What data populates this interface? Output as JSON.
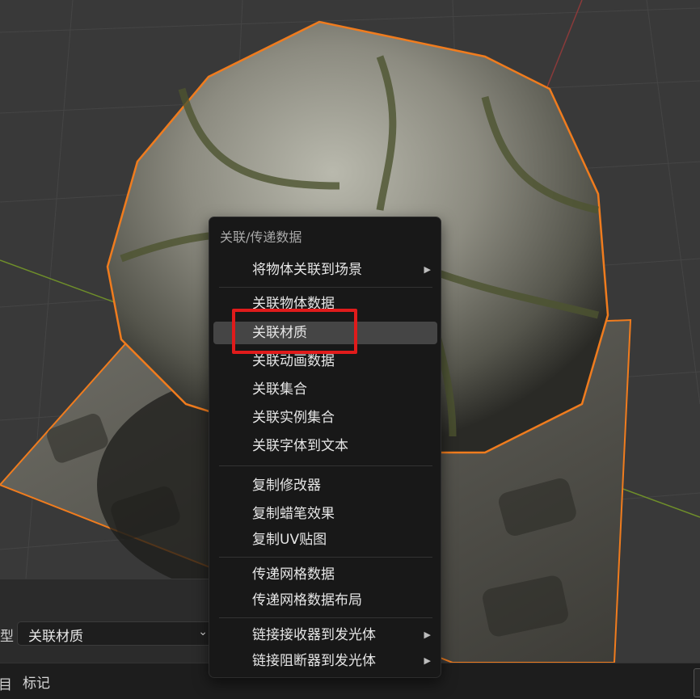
{
  "menu": {
    "title": "关联/传递数据",
    "items": [
      {
        "label": "将物体关联到场景",
        "submenu": "▶"
      },
      {
        "label": "关联物体数据"
      },
      {
        "label": "关联材质"
      },
      {
        "label": "关联动画数据"
      },
      {
        "label": "关联集合"
      },
      {
        "label": "关联实例集合"
      },
      {
        "label": "关联字体到文本"
      },
      {
        "label": "复制修改器"
      },
      {
        "label": "复制蜡笔效果"
      },
      {
        "label": "复制UV贴图"
      },
      {
        "label": "传递网格数据"
      },
      {
        "label": "传递网格数据布局"
      },
      {
        "label": "链接接收器到发光体",
        "submenu": "▶"
      },
      {
        "label": "链接阻断器到发光体",
        "submenu": "▶"
      }
    ],
    "highlighted_index": 2
  },
  "operator_panel": {
    "type_label_partial": "型",
    "type_value": "关联材质",
    "chevron": "⌄"
  },
  "status_bar": {
    "left_partial": "目",
    "marker_label": "标记"
  },
  "colors": {
    "selection_outline": "#f07c1e",
    "annotation_box": "#e01b1b",
    "menu_bg": "#181818",
    "menu_highlight": "#454545"
  }
}
